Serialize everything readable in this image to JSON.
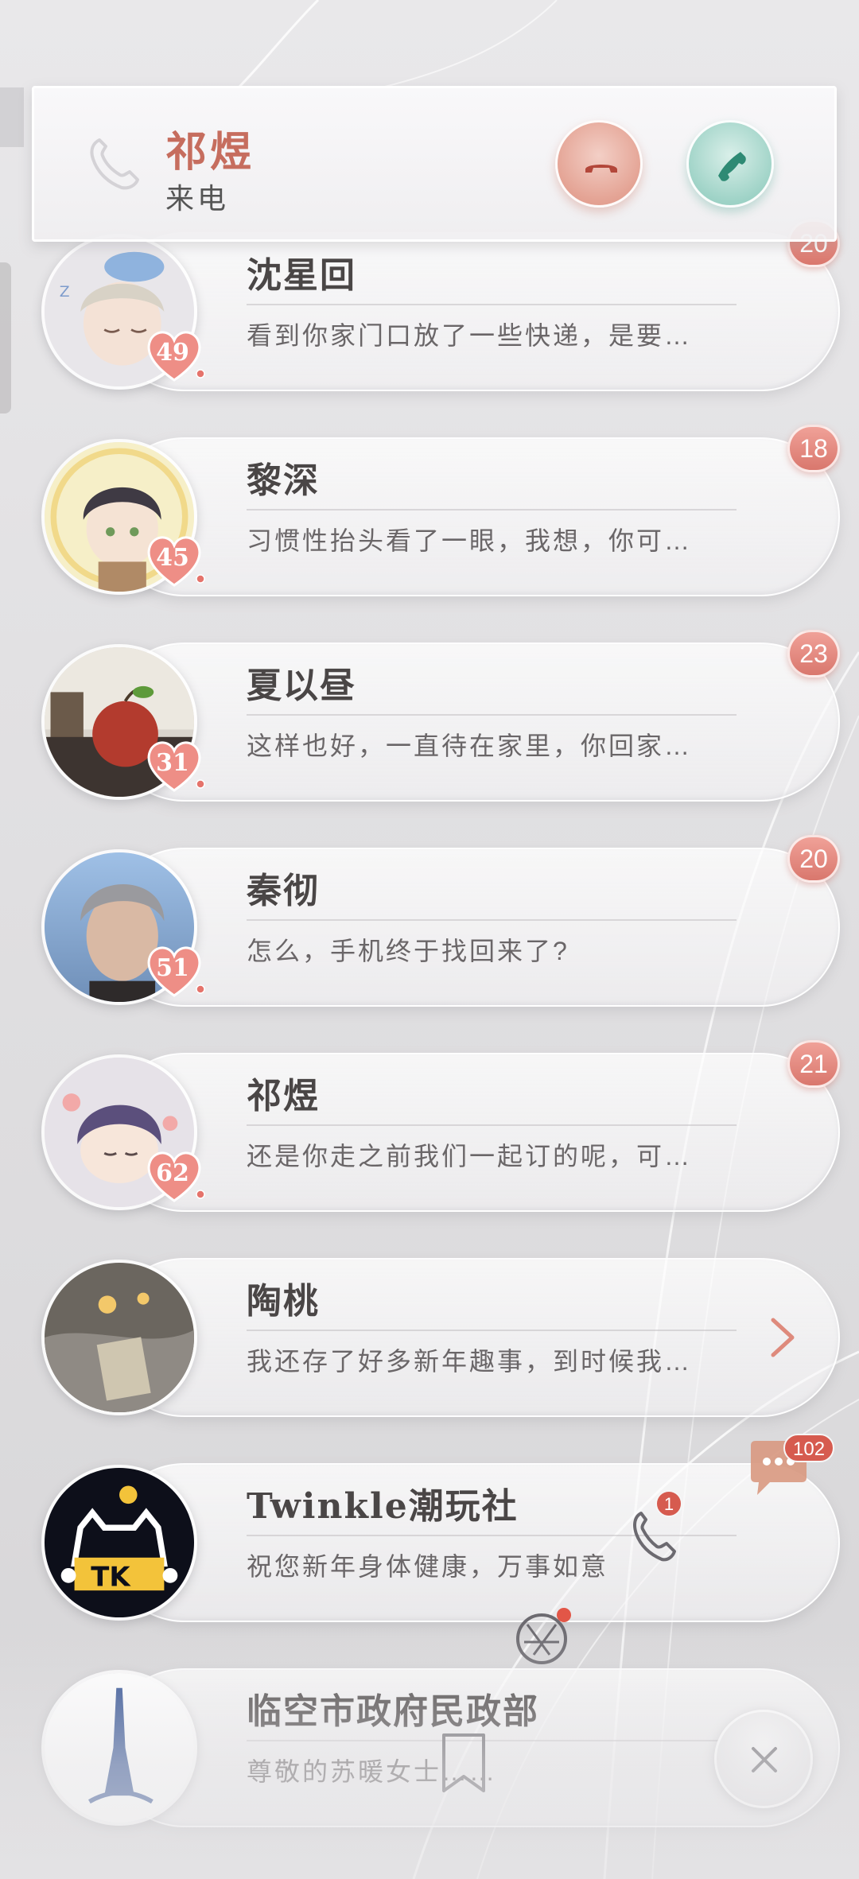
{
  "incoming_call": {
    "caller": "祁煜",
    "type": "来电"
  },
  "chats": [
    {
      "name": "沈星回",
      "preview": "看到你家门口放了一些快递，是要…",
      "affinity": "49",
      "unread": "20"
    },
    {
      "name": "黎深",
      "preview": "习惯性抬头看了一眼，我想，你可…",
      "affinity": "45",
      "unread": "18"
    },
    {
      "name": "夏以昼",
      "preview": "这样也好，一直待在家里，你回家…",
      "affinity": "31",
      "unread": "23"
    },
    {
      "name": "秦彻",
      "preview": "怎么，手机终于找回来了?",
      "affinity": "51",
      "unread": "20"
    },
    {
      "name": "祁煜",
      "preview": "还是你走之前我们一起订的呢，可…",
      "affinity": "62",
      "unread": "21"
    },
    {
      "name": "陶桃",
      "preview": "我还存了好多新年趣事，到时候我…",
      "affinity": "",
      "unread": ""
    },
    {
      "name": "Twinkle潮玩社",
      "preview": "祝您新年身体健康，万事如意",
      "affinity": "",
      "unread": ""
    },
    {
      "name": "临空市政府民政部",
      "preview": "尊敬的苏暖女士……",
      "affinity": "",
      "unread": ""
    }
  ],
  "floating": {
    "chat_badge": "102",
    "phone_badge": "1"
  },
  "colors": {
    "accent_red": "#d9776d",
    "accept_green": "#8cc8ba",
    "name_color": "#c66d5e"
  }
}
